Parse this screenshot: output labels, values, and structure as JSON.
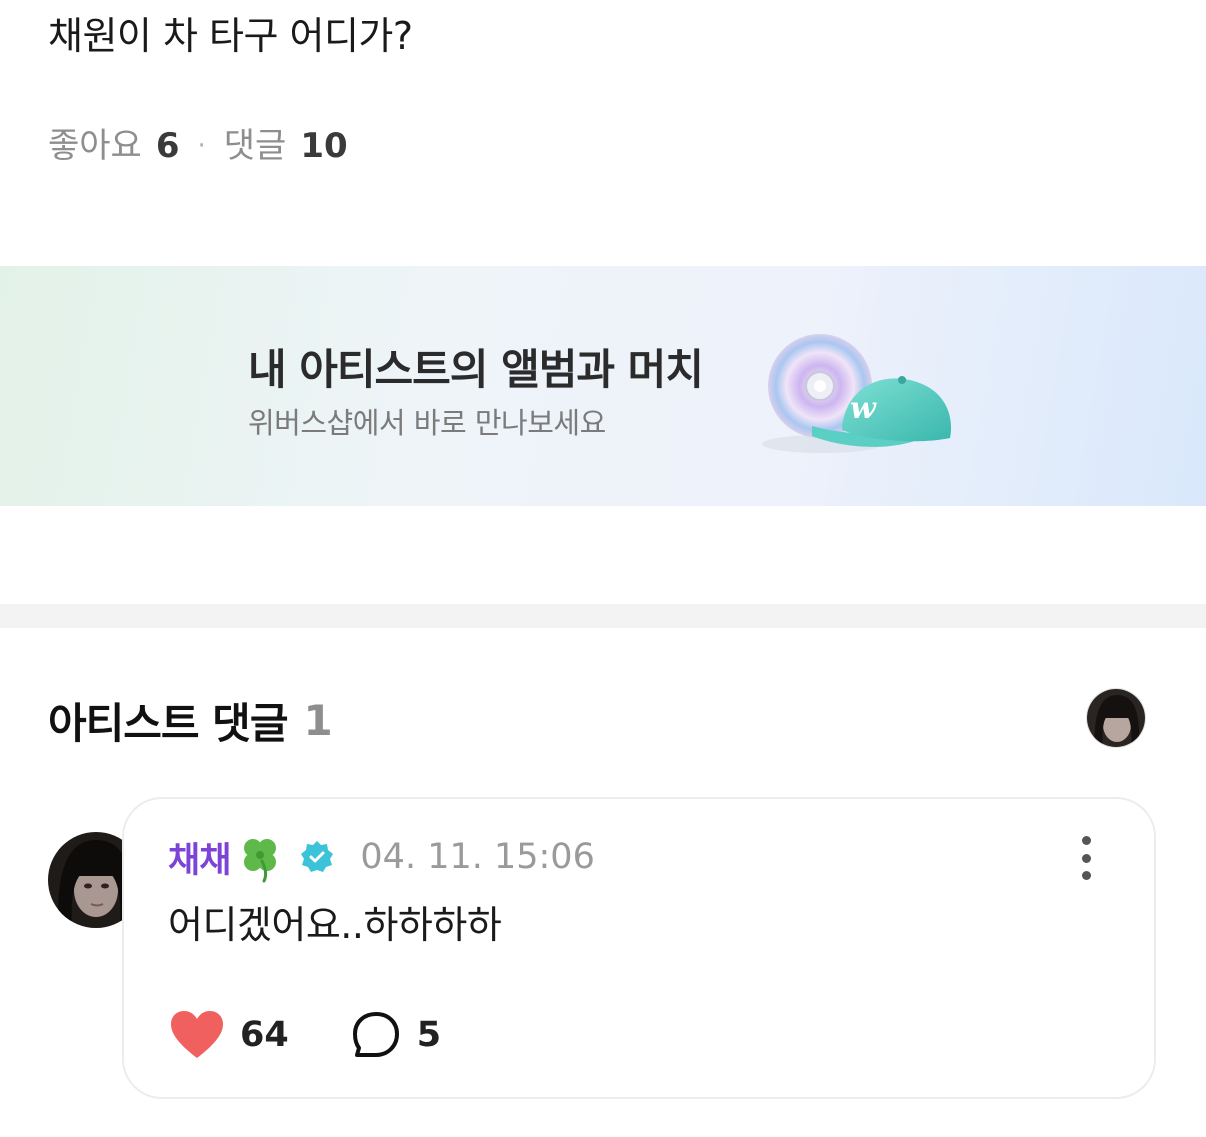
{
  "post": {
    "text": "채원이 차 타구 어디가?",
    "likes_label": "좋아요",
    "likes_count": "6",
    "separator": "·",
    "comments_label": "댓글",
    "comments_count": "10"
  },
  "banner": {
    "title": "내 아티스트의 앨범과 머치",
    "subtitle": "위버스샵에서 바로 만나보세요",
    "cap_logo": "w"
  },
  "artist_comments": {
    "title": "아티스트 댓글",
    "count": "1"
  },
  "comment": {
    "author": "채채",
    "timestamp": "04. 11. 15:06",
    "text": "어디겠어요..하하하하",
    "like_count": "64",
    "reply_count": "5"
  },
  "colors": {
    "author": "#7b43d6",
    "heart": "#f0605e",
    "verified": "#3cc3d9",
    "clover": "#5fb84a"
  },
  "icons": [
    "clover-icon",
    "verified-icon",
    "more-icon",
    "heart-icon",
    "reply-icon"
  ]
}
